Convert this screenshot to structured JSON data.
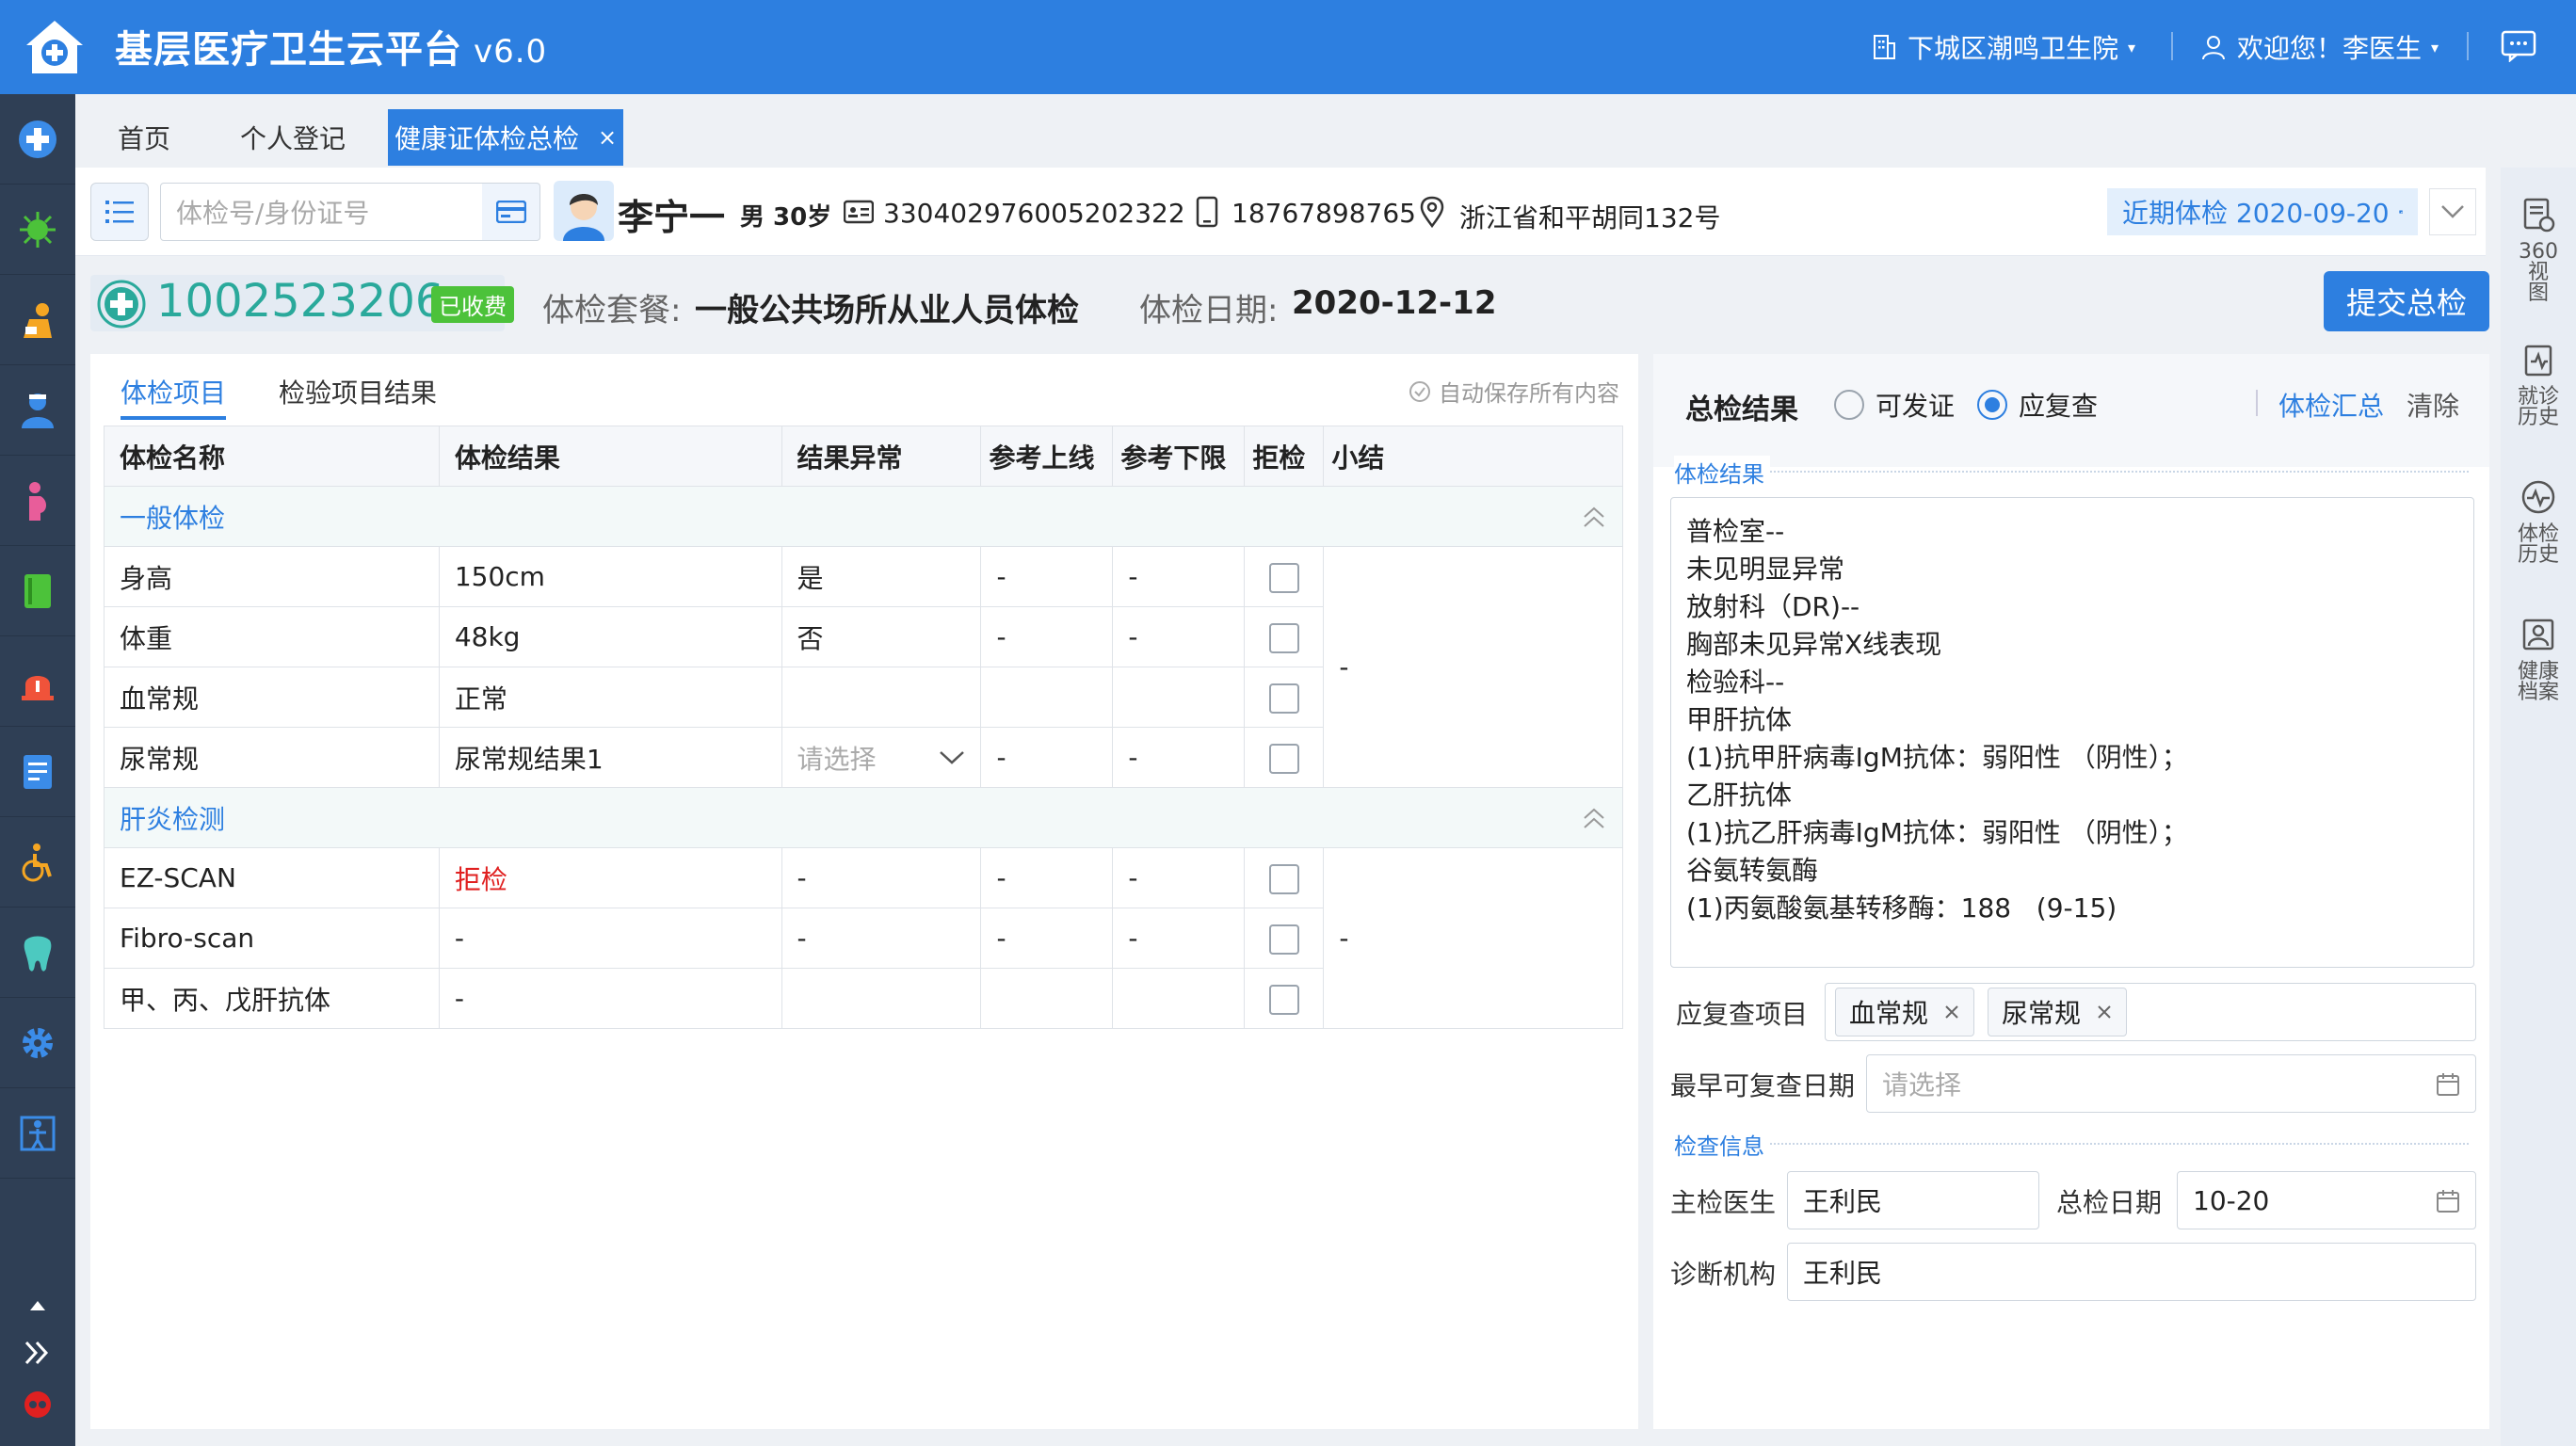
{
  "app": {
    "title": "基层医疗卫生云平台",
    "version": "v6.0"
  },
  "top_right": {
    "org": "下城区潮鸣卫生院",
    "welcome": "欢迎您！李医生"
  },
  "tabs": [
    {
      "label": "首页"
    },
    {
      "label": "个人登记"
    },
    {
      "label": "健康证体检总检",
      "close": "×"
    }
  ],
  "patient": {
    "search_placeholder": "体检号/身份证号",
    "name": "李宁一",
    "gender_age": "男 30岁",
    "id_number": "330402976005202322",
    "phone": "18767898765",
    "address": "浙江省和平胡同132号",
    "recent_exam": "近期体检 2020-09-20"
  },
  "summary": {
    "exam_no": "1002523206",
    "paid_badge": "已收费",
    "package_label": "体检套餐:",
    "package": "一般公共场所从业人员体检",
    "date_label": "体检日期:",
    "date": "2020-12-12",
    "submit_label": "提交总检"
  },
  "left_panel": {
    "tabs": [
      "体检项目",
      "检验项目结果"
    ],
    "autosave": "自动保存所有内容",
    "columns": [
      "体检名称",
      "体检结果",
      "结果异常",
      "参考上线",
      "参考下限",
      "拒检",
      "小结"
    ],
    "groups": [
      {
        "name": "一般体检",
        "summary": "-",
        "rows": [
          {
            "name": "身高",
            "result": "150cm",
            "abnormal": "是",
            "upper": "-",
            "lower": "-"
          },
          {
            "name": "体重",
            "result": "48kg",
            "abnormal": "否",
            "upper": "-",
            "lower": "-"
          },
          {
            "name": "血常规",
            "result": "正常",
            "abnormal": "",
            "upper": "",
            "lower": ""
          },
          {
            "name": "尿常规",
            "result": "尿常规结果1",
            "abnormal_placeholder": "请选择",
            "upper": "-",
            "lower": "-"
          }
        ]
      },
      {
        "name": "肝炎检测",
        "summary": "-",
        "rows": [
          {
            "name": "EZ-SCAN",
            "result": "拒检",
            "abnormal": "-",
            "upper": "-",
            "lower": "-"
          },
          {
            "name": "Fibro-scan",
            "result": "-",
            "abnormal": "-",
            "upper": "-",
            "lower": "-"
          },
          {
            "name": "甲、丙、戊肝抗体",
            "result": "-",
            "abnormal": "",
            "upper": "",
            "lower": ""
          }
        ]
      }
    ]
  },
  "right_panel": {
    "title": "总检结果",
    "radio_1": "可发证",
    "radio_2": "应复查",
    "link_summary": "体检汇总",
    "link_clear": "清除",
    "section_result": "体检结果",
    "result_lines": [
      "普检室--",
      "未见明显异常",
      "放射科（DR)--",
      "胸部未见异常X线表现",
      "检验科--",
      "甲肝抗体",
      "(1)抗甲肝病毒IgM抗体：弱阳性 （阴性）；",
      "乙肝抗体",
      "(1)抗乙肝病毒IgM抗体：弱阳性 （阴性）；",
      "谷氨转氨酶",
      "(1)丙氨酸氨基转移酶：188   (9-15)"
    ],
    "recheck_label": "应复查项目",
    "recheck_tags": [
      "血常规",
      "尿常规"
    ],
    "earliest_label": "最早可复查日期",
    "earliest_placeholder": "请选择",
    "section_info": "检查信息",
    "doctor_label": "主检医生",
    "doctor_value": "王利民",
    "date_label": "总检日期",
    "date_value": "10-20",
    "org_label": "诊断机构",
    "org_value": "王利民"
  },
  "right_sidebar": [
    {
      "label": "360视图"
    },
    {
      "label": "就诊历史"
    },
    {
      "label": "体检历史"
    },
    {
      "label": "健康档案"
    }
  ],
  "colors": {
    "primary": "#2d7fe0",
    "sidebar": "#2f3f55",
    "danger": "#e02020",
    "paid": "#4cc23a",
    "teal": "#2aa99b"
  }
}
